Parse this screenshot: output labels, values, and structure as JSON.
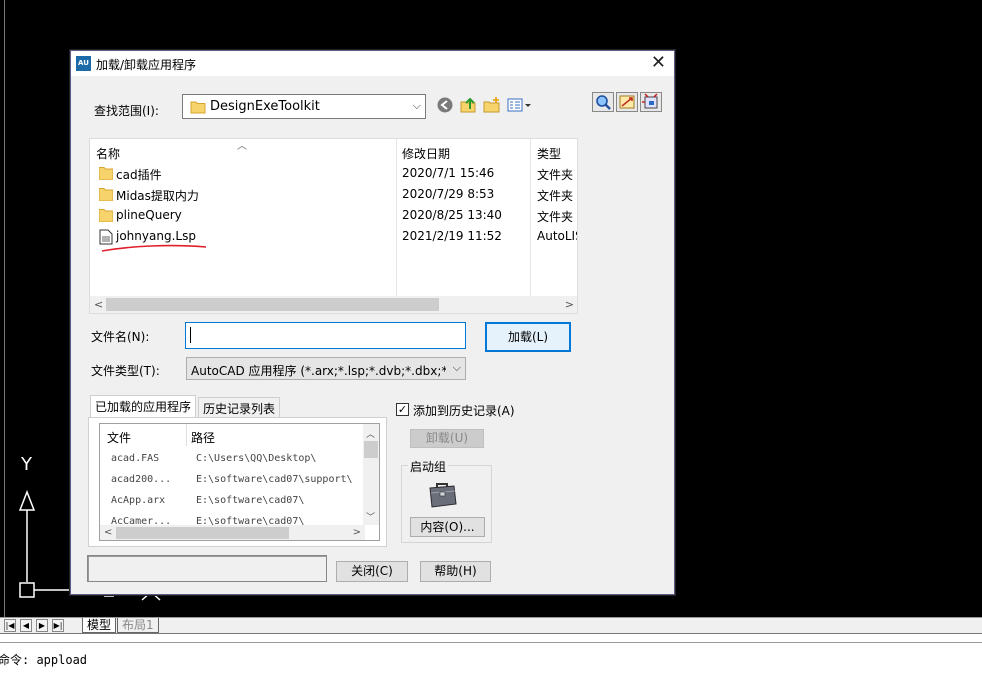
{
  "dialog": {
    "title": "加载/卸载应用程序",
    "app_icon_text": "AU",
    "look_in": {
      "label": "查找范围(I):",
      "value": "DesignExeToolkit"
    },
    "file_list": {
      "columns": [
        "名称",
        "修改日期",
        "类型"
      ],
      "rows": [
        {
          "name": "cad插件",
          "date": "2020/7/1 15:46",
          "type": "文件夹",
          "icon": "folder-icon"
        },
        {
          "name": "Midas提取内力",
          "date": "2020/7/29 8:53",
          "type": "文件夹",
          "icon": "folder-icon"
        },
        {
          "name": "plineQuery",
          "date": "2020/8/25 13:40",
          "type": "文件夹",
          "icon": "folder-icon"
        },
        {
          "name": "johnyang.Lsp",
          "date": "2021/2/19 11:52",
          "type": "AutoLIS",
          "icon": "lsp-file-icon"
        }
      ]
    },
    "file_name": {
      "label": "文件名(N):",
      "value": ""
    },
    "file_type": {
      "label": "文件类型(T):",
      "value": "AutoCAD 应用程序 (*.arx;*.lsp;*.dvb;*.dbx;*.vlx"
    },
    "load_button": "加载(L)",
    "tabs": [
      "已加载的应用程序",
      "历史记录列表"
    ],
    "loaded_apps": {
      "columns": [
        "文件",
        "路径"
      ],
      "rows": [
        {
          "file": "acad.FAS",
          "path": "C:\\Users\\QQ\\Desktop\\"
        },
        {
          "file": "acad200...",
          "path": "E:\\software\\cad07\\support\\"
        },
        {
          "file": "AcApp.arx",
          "path": "E:\\software\\cad07\\"
        },
        {
          "file": "AcCamer...",
          "path": "E:\\software\\cad07\\"
        }
      ]
    },
    "add_to_history": {
      "label": "添加到历史记录(A)",
      "checked": "✓"
    },
    "unload_button": "卸载(U)",
    "startup_group": {
      "title": "启动组",
      "contents_button": "内容(O)..."
    },
    "close_button": "关闭(C)",
    "help_button": "帮助(H)"
  },
  "cad": {
    "ucs_y": "Y",
    "layout_tabs": [
      "模型",
      "布局1"
    ],
    "command_line": "命令: appload"
  },
  "colors": {
    "accent": "#0078d7",
    "annotation_red": "#e0202a"
  }
}
